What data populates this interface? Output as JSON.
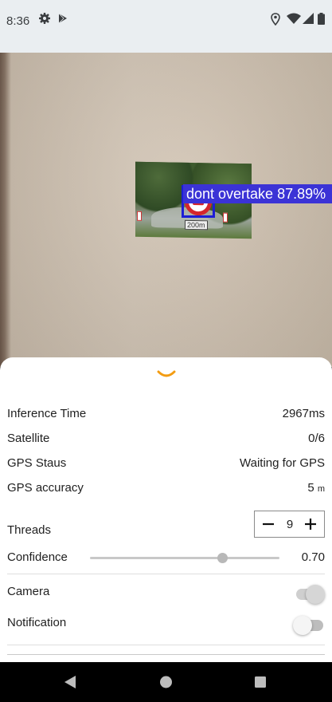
{
  "status_bar": {
    "time": "8:36",
    "left_icons": [
      "gear-icon",
      "play-store-icon"
    ],
    "right_icons": [
      "location-icon",
      "wifi-icon",
      "signal-icon",
      "battery-icon"
    ]
  },
  "camera": {
    "detection": {
      "label": "dont overtake 87.89%",
      "box_color": "#1d1dd6",
      "label_bg": "#3b33d6"
    },
    "sign_plate_text": "200m"
  },
  "sheet": {
    "handle_icon": "chevron-down-icon",
    "handle_color": "#f39c12",
    "rows": [
      {
        "label": "Inference Time",
        "value": "2967ms"
      },
      {
        "label": "Satellite",
        "value": "0/6"
      },
      {
        "label": "GPS Staus",
        "value": "Waiting for GPS"
      },
      {
        "label": "GPS accuracy",
        "value": "5",
        "unit": "m"
      }
    ],
    "threads": {
      "label": "Threads",
      "value": "9",
      "minus": "−",
      "plus": "+"
    },
    "confidence": {
      "label": "Confidence",
      "value": "0.70",
      "slider_level": 0.7
    },
    "camera": {
      "label": "Camera",
      "on": true
    },
    "notification": {
      "label": "Notification",
      "on": false
    }
  },
  "nav_bar": {
    "icons": [
      "back-icon",
      "home-icon",
      "recents-icon"
    ]
  }
}
